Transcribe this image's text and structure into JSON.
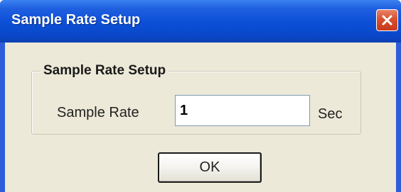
{
  "window": {
    "title": "Sample Rate Setup"
  },
  "group": {
    "legend": "Sample Rate Setup"
  },
  "sample_rate": {
    "label": "Sample Rate",
    "value": "1",
    "unit": "Sec"
  },
  "buttons": {
    "ok_label": "OK"
  },
  "icons": {
    "close": "close-icon"
  },
  "colors": {
    "titlebar": "#0b4fd6",
    "client_background": "#ece9d8",
    "close_button": "#d8502f"
  }
}
